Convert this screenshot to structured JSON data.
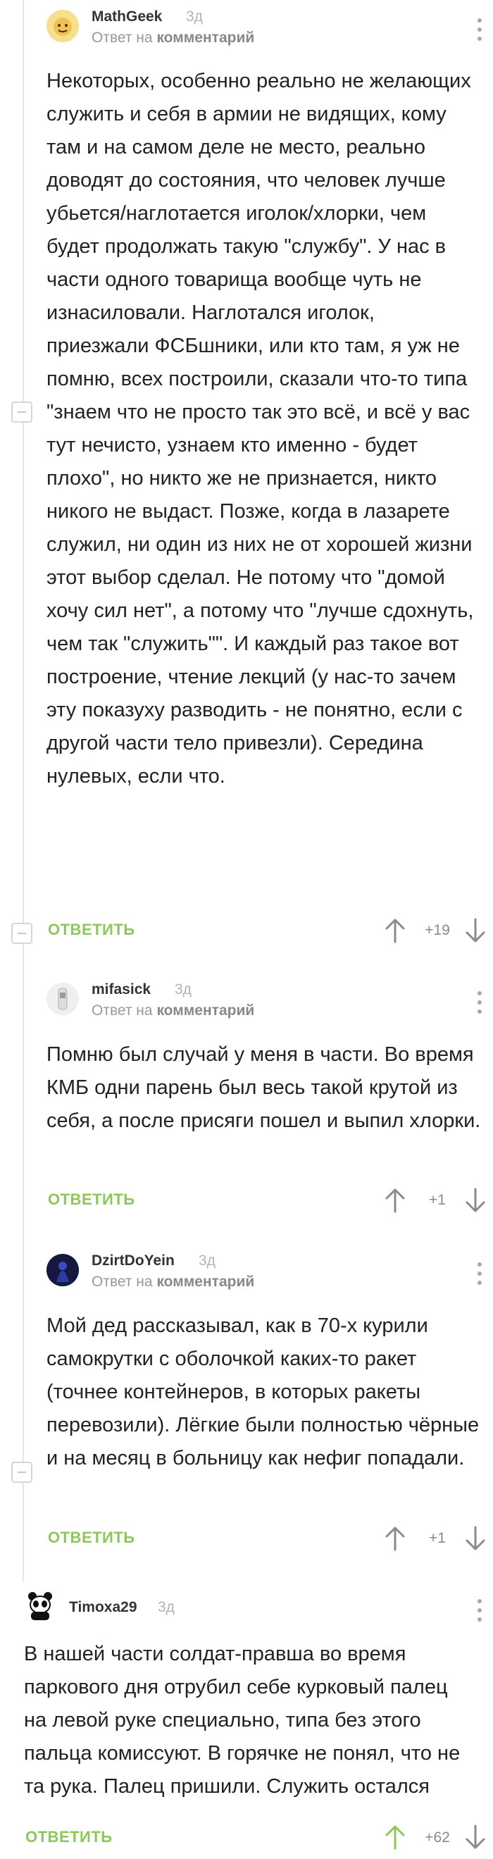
{
  "comments": [
    {
      "author": "MathGeek",
      "time": "3д",
      "reply_prefix": "Ответ на",
      "reply_target": "комментарий",
      "text": "Некоторых, особенно реально не желающих служить и себя в армии не видящих, кому там и на самом деле не место, реально доводят до состояния, что человек лучше убьется/наглотается иголок/хлорки, чем будет продолжать такую \"службу\". У нас в части одного товарища вообще чуть не изнасиловали. Наглотался иголок, приезжали ФСБшники, или кто там, я уж не помню, всех построили, сказали что-то типа \"знаем что не просто так это всё, и всё у вас тут нечисто, узнаем кто именно - будет плохо\", но никто же не признается, никто никого не выдаст. Позже, когда в лазарете служил, ни один из них не от хорошей жизни этот выбор сделал. Не потому что \"домой хочу сил нет\", а потому что \"лучше сдохнуть, чем так \"служить\"\". И каждый раз такое вот построение, чтение лекций (у нас-то зачем эту показуху разводить - не понятно, если с другой части тело привезли). Середина нулевых, если что.",
      "reply_button": "ОТВЕТИТЬ",
      "score": "+19"
    },
    {
      "author": "mifasick",
      "time": "3д",
      "reply_prefix": "Ответ на",
      "reply_target": "комментарий",
      "text": "Помню был случай у меня в части.  Во время КМБ одни парень был весь такой крутой из себя, а после присяги  пошел и выпил хлорки.",
      "reply_button": "ОТВЕТИТЬ",
      "score": "+1"
    },
    {
      "author": "DzirtDoYein",
      "time": "3д",
      "reply_prefix": "Ответ на",
      "reply_target": "комментарий",
      "text": "Мой дед рассказывал, как  в  70-х  курили  самокрутки  с оболочкой каких-то  ракет (точнее контейнеров, в которых ракеты  перевозили).  Лёгкие были полностью чёрные и на месяц в больницу как нефиг попадали.",
      "reply_button": "ОТВЕТИТЬ",
      "score": "+1"
    },
    {
      "author": "Timoxa29",
      "time": "3д",
      "text": "В нашей части солдат-правша во время паркового дня отрубил себе курковый палец на левой руке специально, типа без этого пальца комиссуют. В горячке не понял, что не та рука. Палец пришили. Служить остался",
      "reply_button": "ОТВЕТИТЬ",
      "score": "+62"
    }
  ],
  "colors": {
    "accent": "#8ac858",
    "muted": "#b3b3b3",
    "thread_line": "#e6e6e6"
  },
  "icons": [
    "arrow-up-icon",
    "arrow-down-icon",
    "more-options-icon",
    "collapse-thread-icon"
  ]
}
